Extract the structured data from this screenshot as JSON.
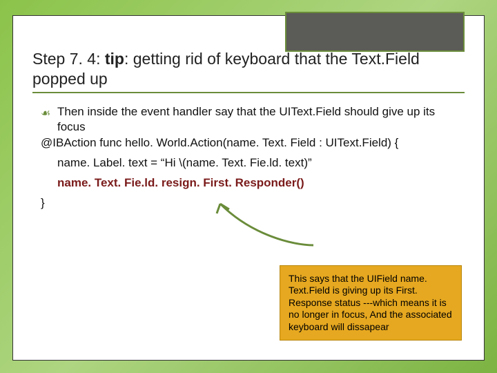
{
  "title": {
    "step": "Step 7. 4: ",
    "tip": "tip",
    "rest": ": getting rid of keyboard that the Text.Field popped up"
  },
  "content": {
    "bullet_text": "Then inside the event handler say that the UIText.Field should give up its focus",
    "code_line1": "@IBAction func hello. World.Action(name. Text. Field : UIText.Field) {",
    "code_line2": "name. Label. text = “Hi \\(name. Text. Fie.ld. text)”",
    "code_line3": "name. Text. Fie.ld. resign. First. Responder()",
    "code_close": "}"
  },
  "callout": {
    "text": "This says that the UIField name. Text.Field is giving up its First. Response status ---which means it is no longer in focus, And the associated keyboard will dissapear"
  },
  "icons": {
    "bullet": "⤵"
  }
}
